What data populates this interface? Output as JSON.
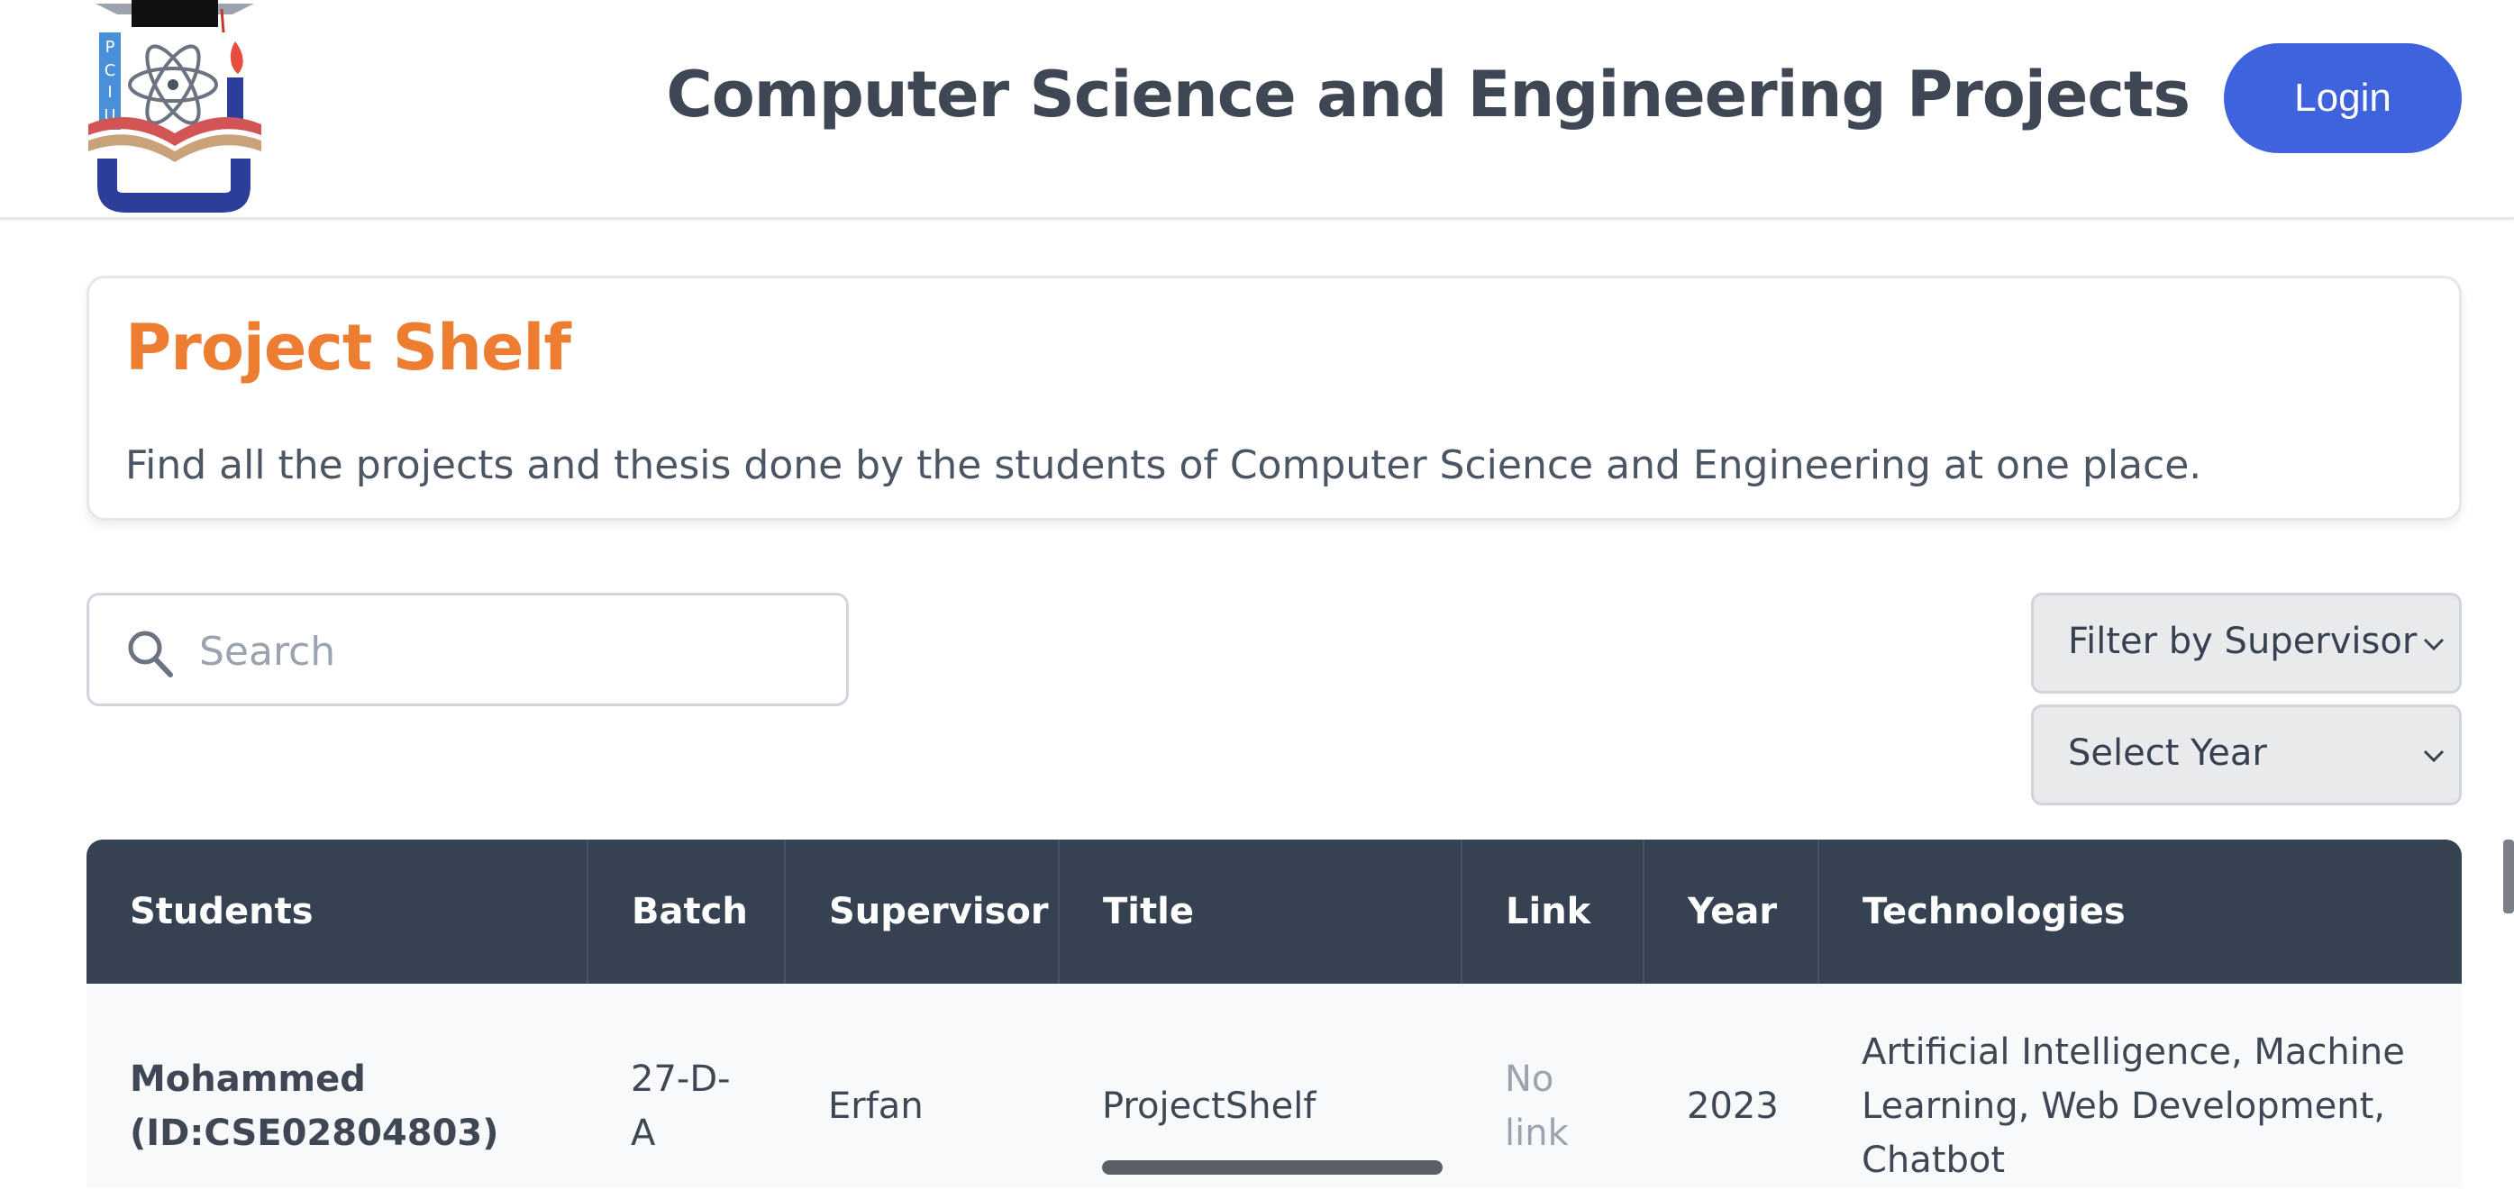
{
  "header": {
    "logo_letters": "PCIU",
    "title": "Computer Science and Engineering Projects",
    "login_label": "Login"
  },
  "intro": {
    "title": "Project Shelf",
    "description": "Find all the projects and thesis done by the students of Computer Science and Engineering at one place."
  },
  "search": {
    "placeholder": "Search",
    "value": ""
  },
  "filters": {
    "supervisor": "Filter by Supervisor",
    "year": "Select Year"
  },
  "table": {
    "headers": [
      "Students",
      "Batch",
      "Supervisor",
      "Title",
      "Link",
      "Year",
      "Technologies"
    ],
    "rows": [
      {
        "student_name": "Mohammed",
        "student_id": "(ID:CSE02804803)",
        "batch_line1": "27-D-",
        "batch_line2": "A",
        "supervisor": "Erfan",
        "title": "ProjectShelf",
        "title_progress": 1.0,
        "link_line1": "No",
        "link_line2": "link",
        "year": "2023",
        "technologies": "Artificial Intelligence, Machine Learning, Web Development, Chatbot"
      }
    ]
  },
  "colors": {
    "accent": "#3e63dd",
    "brand_title": "#ed7d31",
    "table_header": "#364152"
  }
}
